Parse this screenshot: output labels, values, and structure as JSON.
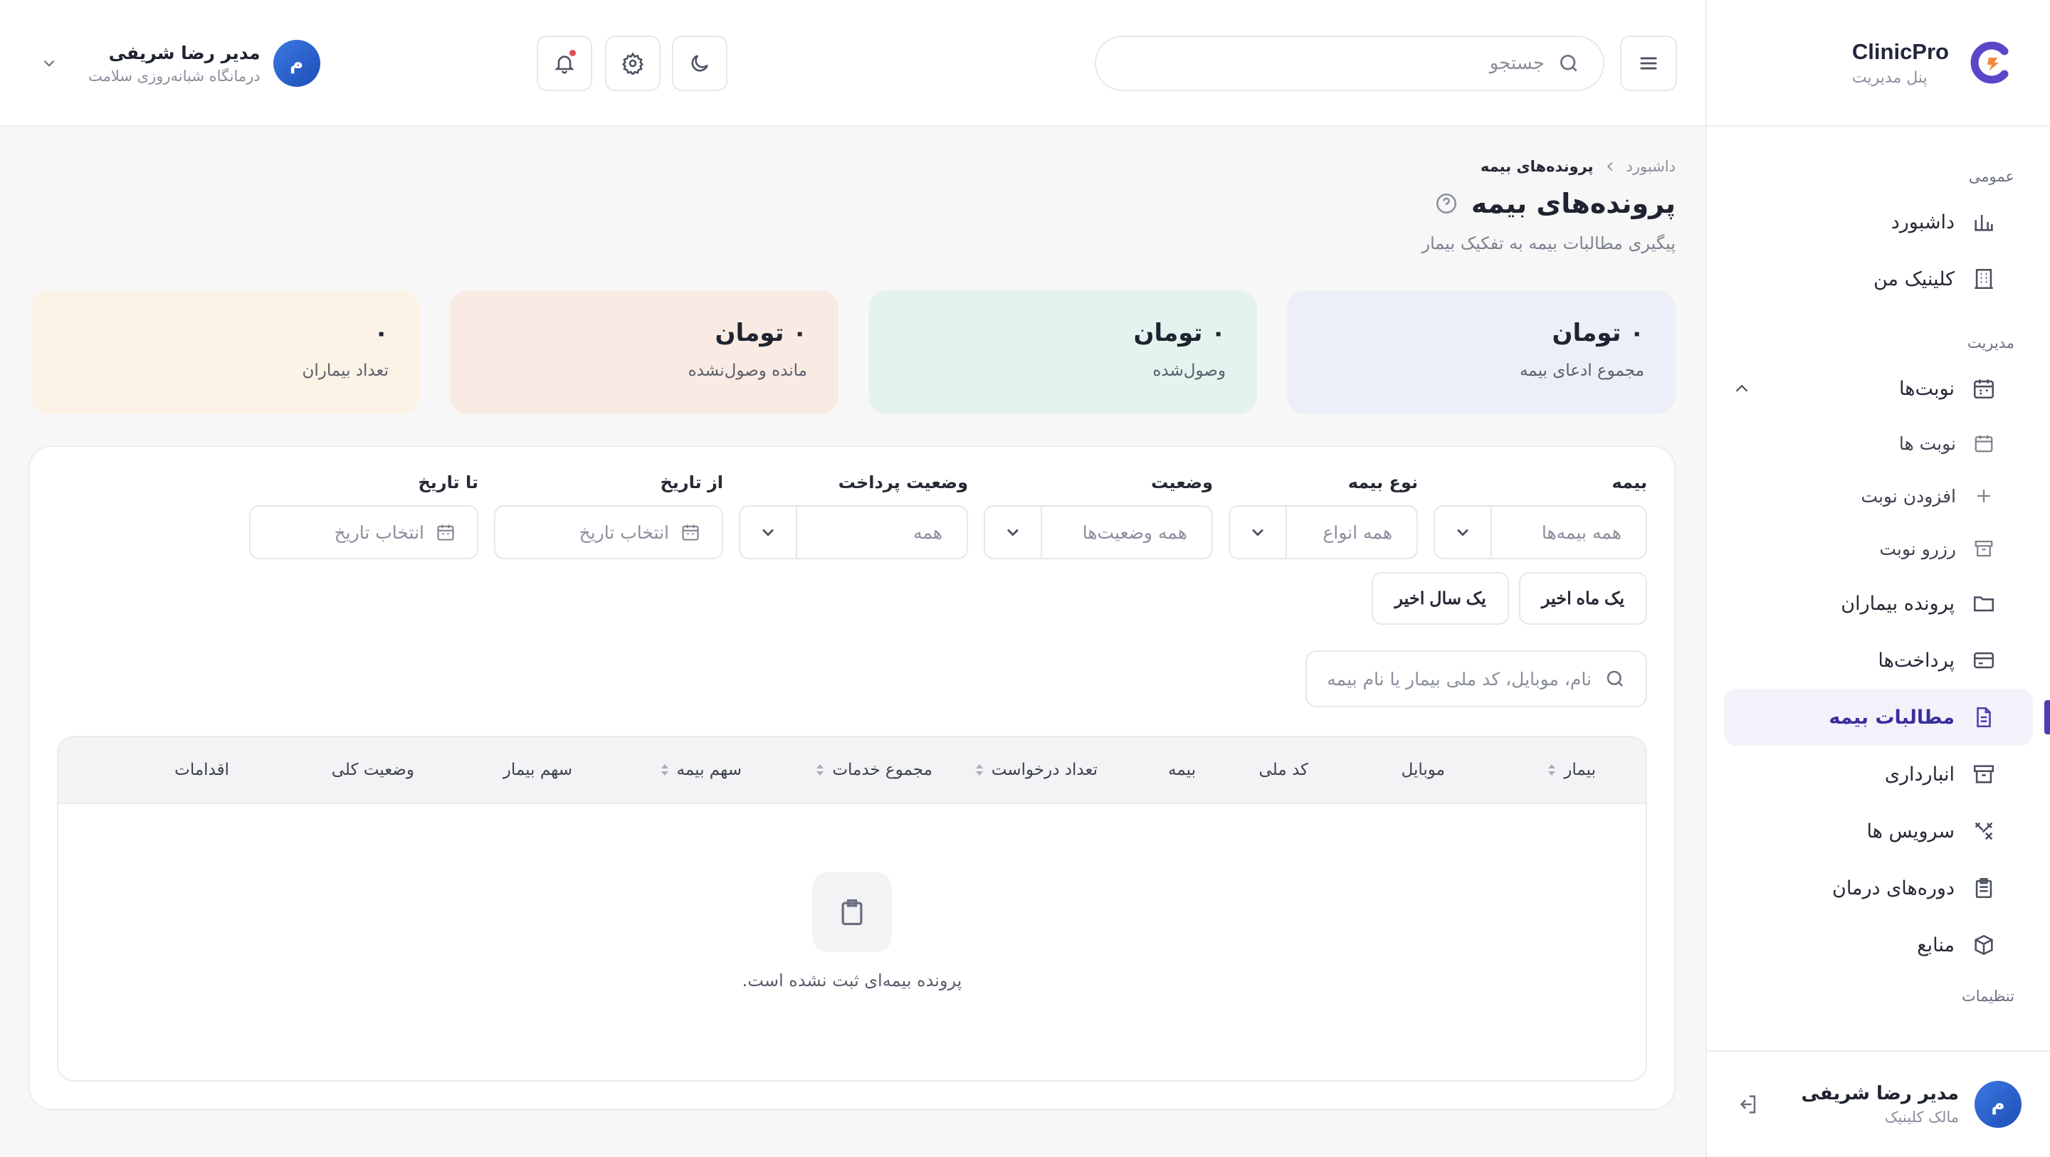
{
  "brand": {
    "name": "ClinicPro",
    "subtitle": "پنل مدیریت"
  },
  "sidebar": {
    "sections": {
      "general": "عمومی",
      "management": "مدیریت",
      "settings": "تنظیمات"
    },
    "items": {
      "dashboard": "داشبورد",
      "my_clinic": "کلینیک من",
      "appointments": "نوبت‌ها",
      "appointments_list": "نوبت ها",
      "add_appointment": "افزودن نوبت",
      "reserve_appointment": "رزرو نوبت",
      "patient_files": "پرونده بیماران",
      "payments": "پرداخت‌ها",
      "insurance_claims": "مطالبات بیمه",
      "inventory": "انبارداری",
      "services": "سرویس ها",
      "treatment_courses": "دوره‌های درمان",
      "resources": "منابع"
    },
    "user": {
      "avatar": "م",
      "name": "مدیر رضا شریفی",
      "role": "مالک کلینیک"
    }
  },
  "topbar": {
    "search_placeholder": "جستجو",
    "user": {
      "avatar": "م",
      "name": "مدیر رضا شریفی",
      "clinic": "درمانگاه شبانه‌روزی سلامت"
    }
  },
  "page": {
    "breadcrumb": {
      "root": "داشبورد",
      "current": "پرونده‌های بیمه"
    },
    "title": "پرونده‌های بیمه",
    "subtitle": "پیگیری مطالبات بیمه به تفکیک بیمار"
  },
  "stats": [
    {
      "value": "۰ تومان",
      "label": "مجموع ادعای بیمه",
      "color": "#eceef8"
    },
    {
      "value": "۰ تومان",
      "label": "وصول‌شده",
      "color": "#e3f3ee"
    },
    {
      "value": "۰ تومان",
      "label": "مانده وصول‌نشده",
      "color": "#f9ebe3"
    },
    {
      "value": "۰",
      "label": "تعداد بیماران",
      "color": "#fbf3e6"
    }
  ],
  "filters": {
    "insurance": {
      "label": "بیمه",
      "value": "همه بیمه‌ها"
    },
    "insurance_type": {
      "label": "نوع بیمه",
      "value": "همه انواع"
    },
    "status": {
      "label": "وضعیت",
      "value": "همه وضعیت‌ها"
    },
    "payment_status": {
      "label": "وضعیت پرداخت",
      "value": "همه"
    },
    "from_date": {
      "label": "از تاریخ",
      "placeholder": "انتخاب تاریخ"
    },
    "to_date": {
      "label": "تا تاریخ",
      "placeholder": "انتخاب تاریخ"
    },
    "quick": {
      "last_month": "یک ماه اخیر",
      "last_year": "یک سال اخیر"
    },
    "search_placeholder": "نام، موبایل، کد ملی بیمار یا نام بیمه"
  },
  "table": {
    "columns": [
      "بیمار",
      "موبایل",
      "کد ملی",
      "بیمه",
      "تعداد درخواست",
      "مجموع خدمات",
      "سهم بیمه",
      "سهم بیمار",
      "وضعیت کلی",
      "اقدامات"
    ],
    "empty_text": "پرونده بیمه‌ای ثبت نشده است."
  },
  "colors": {
    "accent": "#4a3fb0",
    "avatar": "#2d62cf",
    "notification": "#e14b5a"
  }
}
